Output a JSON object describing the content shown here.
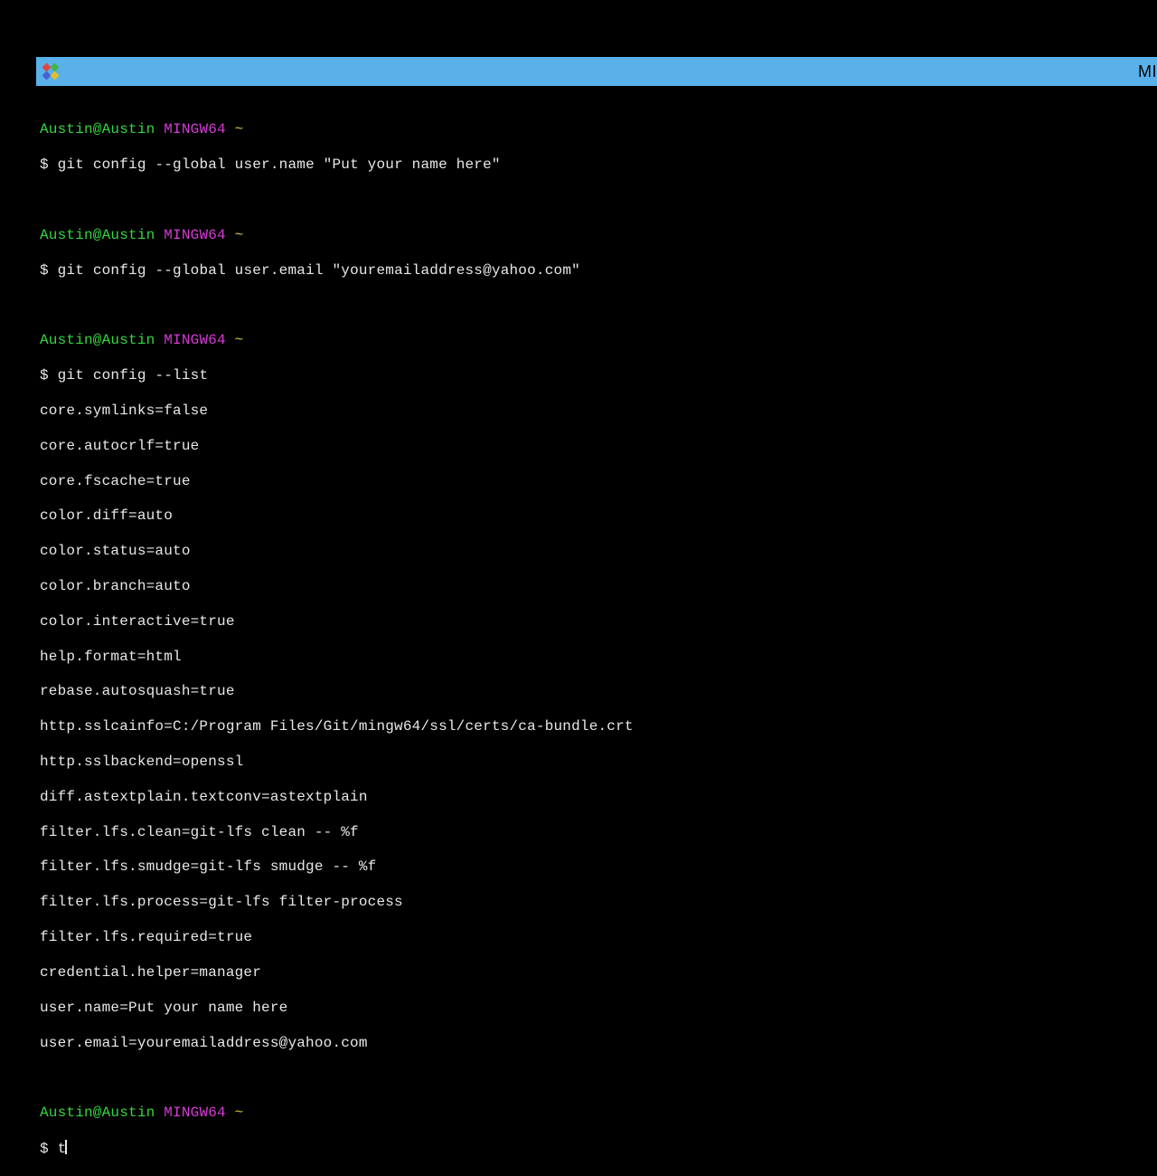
{
  "titlebar": {
    "title_fragment": "MI"
  },
  "prompt": {
    "user_host": "Austin@Austin",
    "context": "MINGW64",
    "path": "~",
    "symbol": "$"
  },
  "blocks": [
    {
      "command": "git config --global user.name \"Put your name here\"",
      "output": []
    },
    {
      "command": "git config --global user.email \"youremailaddress@yahoo.com\"",
      "output": []
    },
    {
      "command": "git config --list",
      "output": [
        "core.symlinks=false",
        "core.autocrlf=true",
        "core.fscache=true",
        "color.diff=auto",
        "color.status=auto",
        "color.branch=auto",
        "color.interactive=true",
        "help.format=html",
        "rebase.autosquash=true",
        "http.sslcainfo=C:/Program Files/Git/mingw64/ssl/certs/ca-bundle.crt",
        "http.sslbackend=openssl",
        "diff.astextplain.textconv=astextplain",
        "filter.lfs.clean=git-lfs clean -- %f",
        "filter.lfs.smudge=git-lfs smudge -- %f",
        "filter.lfs.process=git-lfs filter-process",
        "filter.lfs.required=true",
        "credential.helper=manager",
        "user.name=Put your name here",
        "user.email=youremailaddress@yahoo.com"
      ]
    }
  ],
  "current_input": "t"
}
